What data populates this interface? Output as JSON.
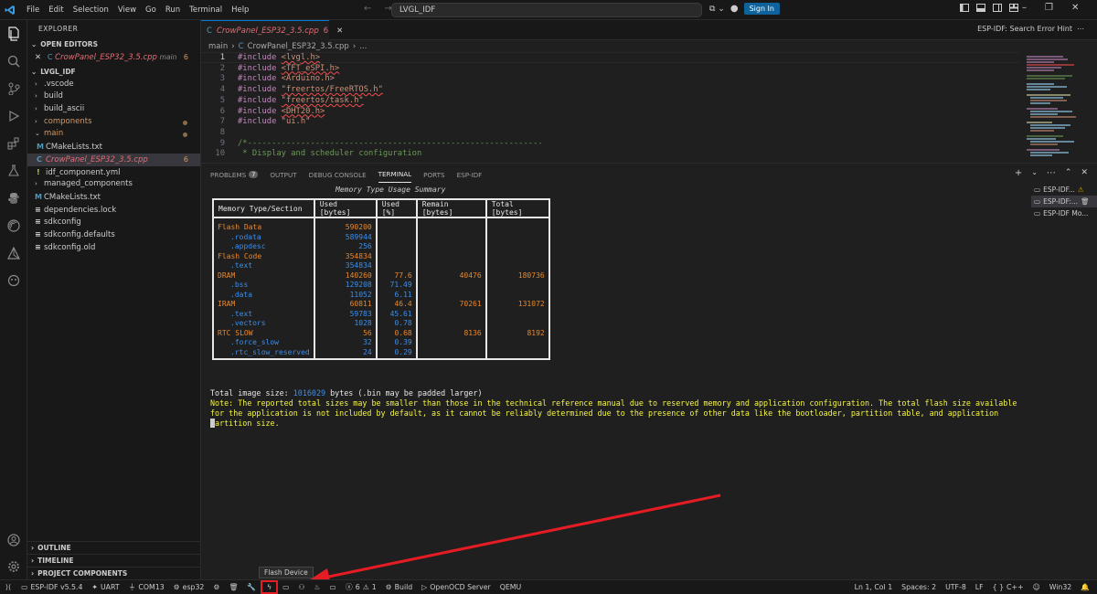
{
  "titlebar": {
    "menu": [
      "File",
      "Edit",
      "Selection",
      "View",
      "Go",
      "Run",
      "Terminal",
      "Help"
    ],
    "search": "LVGL_IDF",
    "sign_in": "Sign In"
  },
  "sidebar": {
    "header": "EXPLORER",
    "open_editors": {
      "title": "OPEN EDITORS",
      "file": "CrowPanel_ESP32_3.5.cpp",
      "tag": "main",
      "count": "6"
    },
    "project": {
      "title": "LVGL_IDF",
      "items": [
        {
          "label": ".vscode"
        },
        {
          "label": "build"
        },
        {
          "label": "build_ascii"
        },
        {
          "label": "components"
        },
        {
          "label": "main"
        },
        {
          "label": "CMakeLists.txt"
        },
        {
          "label": "CrowPanel_ESP32_3.5.cpp",
          "count": "6"
        },
        {
          "label": "idf_component.yml"
        },
        {
          "label": "managed_components"
        },
        {
          "label": "CMakeLists.txt"
        },
        {
          "label": "dependencies.lock"
        },
        {
          "label": "sdkconfig"
        },
        {
          "label": "sdkconfig.defaults"
        },
        {
          "label": "sdkconfig.old"
        }
      ]
    },
    "bottom_sections": [
      "OUTLINE",
      "TIMELINE",
      "PROJECT COMPONENTS"
    ]
  },
  "editor": {
    "tab": {
      "file": "CrowPanel_ESP32_3.5.cpp",
      "count": "6"
    },
    "hint": "ESP-IDF: Search Error Hint",
    "breadcrumb": [
      "main",
      "CrowPanel_ESP32_3.5.cpp",
      "..."
    ],
    "lines": [
      {
        "n": "1",
        "kw": "#include",
        "arg": "<lvgl.h>",
        "squig": true
      },
      {
        "n": "2",
        "kw": "#include",
        "arg": "<TFT_eSPI.h>",
        "squig": true
      },
      {
        "n": "3",
        "kw": "#include",
        "arg": "<Arduino.h>",
        "squig": false
      },
      {
        "n": "4",
        "kw": "#include",
        "arg": "\"freertos/FreeRTOS.h\"",
        "squig": true
      },
      {
        "n": "5",
        "kw": "#include",
        "arg": "\"freertos/task.h\"",
        "squig": true
      },
      {
        "n": "6",
        "kw": "#include",
        "arg": "<DHT20.h>",
        "squig": true
      },
      {
        "n": "7",
        "kw": "#include",
        "arg": "\"ui.h\"",
        "squig": false
      },
      {
        "n": "8",
        "kw": "",
        "arg": "",
        "squig": false
      },
      {
        "n": "9",
        "kw": "/*-------------------------------------------------------------",
        "arg": "",
        "squig": false,
        "comment": true
      },
      {
        "n": "10",
        "kw": " * Display and scheduler configuration",
        "arg": "",
        "squig": false,
        "comment": true
      }
    ]
  },
  "panel": {
    "tabs": [
      "PROBLEMS",
      "OUTPUT",
      "DEBUG CONSOLE",
      "TERMINAL",
      "PORTS",
      "ESP-IDF"
    ],
    "problems_count": "7",
    "terminal": {
      "title": "Memory Type Usage Summary",
      "headers": [
        "Memory Type/Section",
        "Used [bytes]",
        "Used [%]",
        "Remain [bytes]",
        "Total [bytes]"
      ],
      "groups": [
        {
          "rows": [
            {
              "name": "Flash Data",
              "used": "590200",
              "pct": "",
              "remain": "",
              "total": "",
              "sub": false
            },
            {
              "name": ".rodata",
              "used": "589944",
              "pct": "",
              "remain": "",
              "total": "",
              "sub": true
            },
            {
              "name": ".appdesc",
              "used": "256",
              "pct": "",
              "remain": "",
              "total": "",
              "sub": true
            },
            {
              "name": "Flash Code",
              "used": "354834",
              "pct": "",
              "remain": "",
              "total": "",
              "sub": false
            },
            {
              "name": ".text",
              "used": "354834",
              "pct": "",
              "remain": "",
              "total": "",
              "sub": true
            },
            {
              "name": "DRAM",
              "used": "140260",
              "pct": "77.6",
              "remain": "40476",
              "total": "180736",
              "sub": false
            },
            {
              "name": ".bss",
              "used": "129208",
              "pct": "71.49",
              "remain": "",
              "total": "",
              "sub": true
            },
            {
              "name": ".data",
              "used": "11052",
              "pct": "6.11",
              "remain": "",
              "total": "",
              "sub": true
            },
            {
              "name": "IRAM",
              "used": "60811",
              "pct": "46.4",
              "remain": "70261",
              "total": "131072",
              "sub": false
            },
            {
              "name": ".text",
              "used": "59783",
              "pct": "45.61",
              "remain": "",
              "total": "",
              "sub": true
            },
            {
              "name": ".vectors",
              "used": "1028",
              "pct": "0.78",
              "remain": "",
              "total": "",
              "sub": true
            },
            {
              "name": "RTC SLOW",
              "used": "56",
              "pct": "0.68",
              "remain": "8136",
              "total": "8192",
              "sub": false
            },
            {
              "name": ".force_slow",
              "used": "32",
              "pct": "0.39",
              "remain": "",
              "total": "",
              "sub": true
            },
            {
              "name": ".rtc_slow_reserved",
              "used": "24",
              "pct": "0.29",
              "remain": "",
              "total": "",
              "sub": true
            }
          ]
        }
      ],
      "total_prefix": "Total image size: ",
      "total_value": "1016029",
      "total_suffix": " bytes (.bin may be padded larger)",
      "note": "Note: The reported total sizes may be smaller than those in the technical reference manual due to reserved memory and application configuration. The total flash size available for the application is not included by default, as it cannot be reliably determined due to the presence of other data like the bootloader, partition table, and application partition size."
    },
    "terminal_list": [
      "ESP-IDF...",
      "ESP-IDF:...",
      "ESP-IDF Mo..."
    ]
  },
  "tooltip": "Flash Device",
  "statusbar": {
    "idf": "ESP-IDF v5.5.4",
    "uart": "UART",
    "port": "COM13",
    "target": "esp32",
    "errors": "6",
    "warnings": "1",
    "build": "Build",
    "openocd": "OpenOCD Server",
    "qemu": "QEMU",
    "position": "Ln 1, Col 1",
    "spaces": "Spaces: 2",
    "encoding": "UTF-8",
    "eol": "LF",
    "lang": "C++",
    "platform": "Win32"
  },
  "colors": {
    "accent": "#0078d4",
    "annotation": "#e51c23"
  }
}
